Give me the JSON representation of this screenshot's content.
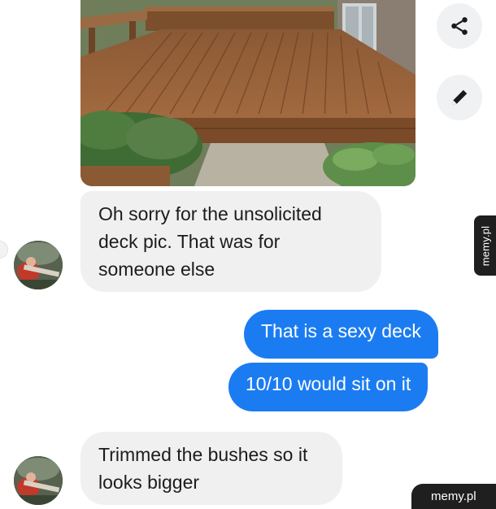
{
  "messages": [
    {
      "direction": "incoming",
      "lines": [
        "Oh sorry for the unsolicited",
        "deck pic. That was for",
        "someone else"
      ]
    },
    {
      "direction": "outgoing",
      "text": "That is a sexy deck"
    },
    {
      "direction": "outgoing",
      "text": "10/10 would sit on it"
    },
    {
      "direction": "incoming",
      "lines": [
        "Trimmed the bushes so it",
        "looks bigger"
      ]
    }
  ],
  "actions": {
    "share_icon": "share-icon",
    "edit_icon": "pencil-icon"
  },
  "watermark": {
    "side": "memy.pl",
    "bottom": "memy.pl"
  },
  "colors": {
    "outgoing_bubble": "#1b7cf2",
    "incoming_bubble": "#f0f0f0",
    "action_button": "#f0f1f3",
    "watermark_bg": "#1f1f1f"
  }
}
